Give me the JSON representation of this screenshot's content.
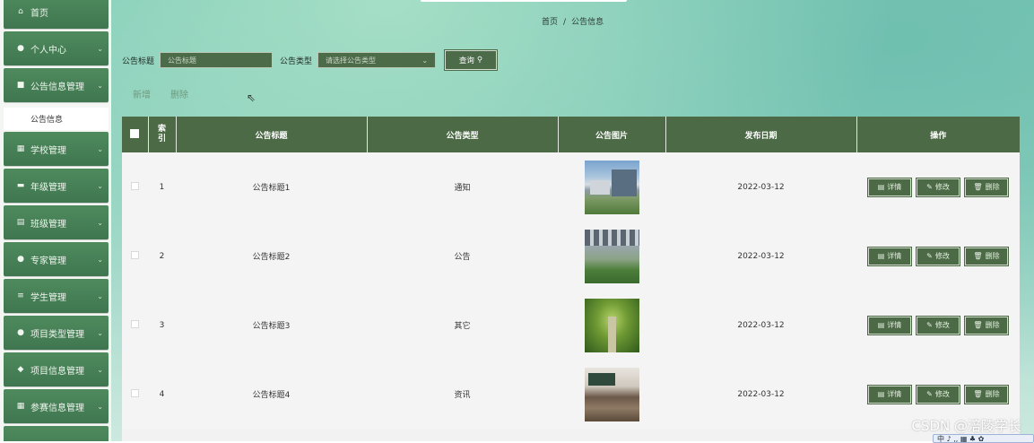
{
  "sidebar": {
    "items": [
      {
        "icon": "home-icon",
        "glyph": "⌂",
        "label": "首页",
        "chevron": false
      },
      {
        "icon": "user-icon",
        "glyph": "●",
        "label": "个人中心",
        "chevron": true
      },
      {
        "icon": "notice-icon",
        "glyph": "■",
        "label": "公告信息管理",
        "chevron": true
      },
      {
        "icon": "school-icon",
        "glyph": "▦",
        "label": "学校管理",
        "chevron": true
      },
      {
        "icon": "grade-icon",
        "glyph": "▬",
        "label": "年级管理",
        "chevron": true
      },
      {
        "icon": "class-icon",
        "glyph": "▤",
        "label": "班级管理",
        "chevron": true
      },
      {
        "icon": "expert-icon",
        "glyph": "●",
        "label": "专家管理",
        "chevron": true
      },
      {
        "icon": "student-icon",
        "glyph": "≡",
        "label": "学生管理",
        "chevron": true
      },
      {
        "icon": "project-type-icon",
        "glyph": "●",
        "label": "项目类型管理",
        "chevron": true
      },
      {
        "icon": "project-info-icon",
        "glyph": "◆",
        "label": "项目信息管理",
        "chevron": true
      },
      {
        "icon": "competition-icon",
        "glyph": "▦",
        "label": "参赛信息管理",
        "chevron": true
      }
    ],
    "sub_active": "公告信息"
  },
  "breadcrumb": {
    "home": "首页",
    "separator": "/",
    "current": "公告信息"
  },
  "search": {
    "title_label": "公告标题",
    "title_placeholder": "公告标题",
    "type_label": "公告类型",
    "type_placeholder": "请选择公告类型",
    "query_button": "查询"
  },
  "actions": {
    "add": "新增",
    "delete": "删除"
  },
  "table": {
    "headers": {
      "index": "索引",
      "title": "公告标题",
      "type": "公告类型",
      "image": "公告图片",
      "date": "发布日期",
      "ops": "操作"
    },
    "rows": [
      {
        "index": "1",
        "title": "公告标题1",
        "type": "通知",
        "date": "2022-03-12"
      },
      {
        "index": "2",
        "title": "公告标题2",
        "type": "公告",
        "date": "2022-03-12"
      },
      {
        "index": "3",
        "title": "公告标题3",
        "type": "其它",
        "date": "2022-03-12"
      },
      {
        "index": "4",
        "title": "公告标题4",
        "type": "资讯",
        "date": "2022-03-12"
      }
    ],
    "ops": {
      "detail": "详情",
      "edit": "修改",
      "delete": "删除"
    }
  },
  "watermark": "CSDN @涪陵学长",
  "ime": "中 ♪ ,, ▦ ♣ ✿"
}
